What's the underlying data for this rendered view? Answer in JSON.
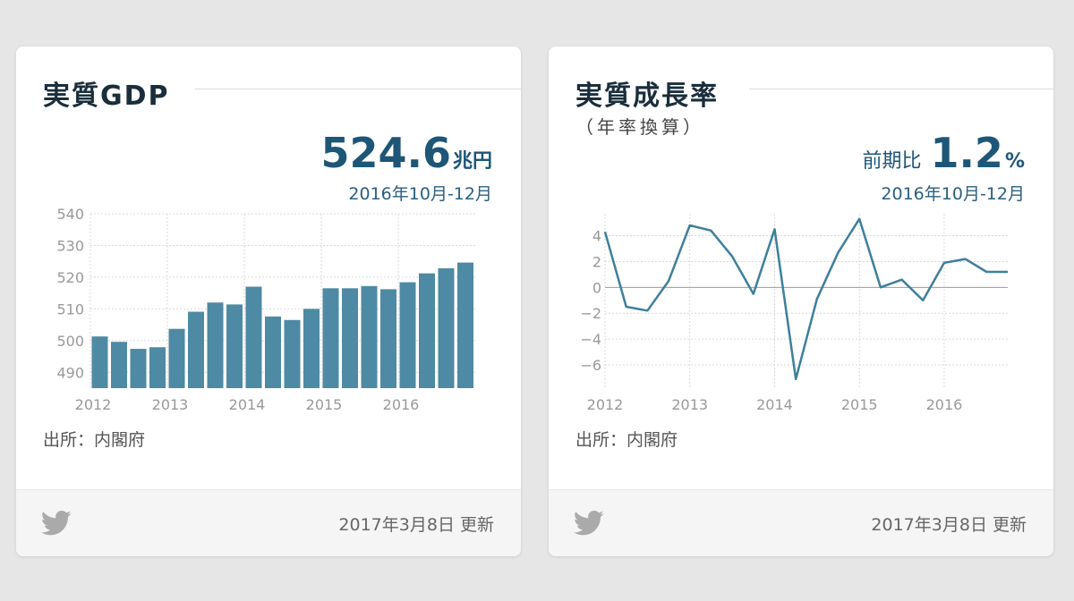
{
  "cards": [
    {
      "title": "実質GDP",
      "headline_value": "524.6",
      "headline_unit": "兆円",
      "period": "2016年10月-12月",
      "source": "出所：内閣府",
      "updated": "2017年3月8日 更新",
      "share_icon": "twitter-icon"
    },
    {
      "title": "実質成長率",
      "subtitle": "（年率換算）",
      "headline_prefix": "前期比",
      "headline_value": "1.2",
      "headline_unit": "%",
      "period": "2016年10月-12月",
      "source": "出所：内閣府",
      "updated": "2017年3月8日 更新",
      "share_icon": "twitter-icon"
    }
  ],
  "colors": {
    "bar": "#4e8aa3",
    "line": "#3e7f9c",
    "title": "#1a2e3b",
    "headline": "#1d5677",
    "grid": "#d9d9d9",
    "zero_line": "#9a9a9a",
    "tick": "#999999",
    "twitter": "#aaaaaa"
  },
  "chart_data": [
    {
      "type": "bar",
      "x_ticks": [
        "2012",
        "2013",
        "2014",
        "2015",
        "2016"
      ],
      "y_ticks": [
        490,
        500,
        510,
        520,
        530,
        540
      ],
      "ylim": [
        485,
        540
      ],
      "grid": true,
      "categories": [
        "2012Q1",
        "2012Q2",
        "2012Q3",
        "2012Q4",
        "2013Q1",
        "2013Q2",
        "2013Q3",
        "2013Q4",
        "2014Q1",
        "2014Q2",
        "2014Q3",
        "2014Q4",
        "2015Q1",
        "2015Q2",
        "2015Q3",
        "2015Q4",
        "2016Q1",
        "2016Q2",
        "2016Q3",
        "2016Q4"
      ],
      "values": [
        501.3,
        499.6,
        497.4,
        497.9,
        503.7,
        509.1,
        512.0,
        511.4,
        517.0,
        507.6,
        506.5,
        510.0,
        516.5,
        516.5,
        517.2,
        516.2,
        518.4,
        521.2,
        522.8,
        524.6
      ]
    },
    {
      "type": "line",
      "x_ticks": [
        "2012",
        "2013",
        "2014",
        "2015",
        "2016"
      ],
      "y_ticks": [
        -6,
        -4,
        -2,
        0,
        2,
        4
      ],
      "ylim": [
        -7.8,
        5.7
      ],
      "grid": true,
      "categories": [
        "2012Q1",
        "2012Q2",
        "2012Q3",
        "2012Q4",
        "2013Q1",
        "2013Q2",
        "2013Q3",
        "2013Q4",
        "2014Q1",
        "2014Q2",
        "2014Q3",
        "2014Q4",
        "2015Q1",
        "2015Q2",
        "2015Q3",
        "2015Q4",
        "2016Q1",
        "2016Q2",
        "2016Q3",
        "2016Q4"
      ],
      "values": [
        4.3,
        -1.5,
        -1.8,
        0.5,
        4.8,
        4.4,
        2.4,
        -0.5,
        4.5,
        -7.1,
        -0.9,
        2.7,
        5.3,
        0.0,
        0.6,
        -1.0,
        1.9,
        2.2,
        1.2,
        1.2
      ]
    }
  ]
}
